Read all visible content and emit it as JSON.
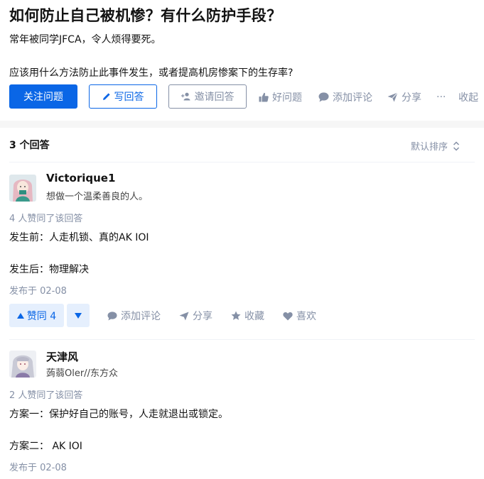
{
  "question": {
    "title": "如何防止自己被机惨？有什么防护手段？",
    "desc_line1": "常年被同学JFCA，令人烦得要死。",
    "desc_line2": "应该用什么方法防止此事件发生，或者提高机房惨案下的生存率?",
    "buttons": {
      "follow": "关注问题",
      "write": "写回答",
      "invite": "邀请回答"
    },
    "actions": {
      "good": "好问题",
      "comment": "添加评论",
      "share": "分享",
      "more": "···",
      "collect": "收起"
    }
  },
  "answers_header": {
    "count_label": "3 个回答",
    "sort_label": "默认排序"
  },
  "answers": [
    {
      "author": "Victorique1",
      "bio": "想做一个温柔善良的人。",
      "votes_text": "4 人赞同了该回答",
      "content": [
        "发生前：人走机锁、真的AK IOI",
        "发生后：物理解决"
      ],
      "date": "发布于 02-08",
      "vote_label": "赞同 4",
      "actions": {
        "comment": "添加评论",
        "share": "分享",
        "collect": "收藏",
        "like": "喜欢"
      }
    },
    {
      "author": "天津风",
      "bio": "蒟蒻Oler//东方众",
      "votes_text": "2 人赞同了该回答",
      "content": [
        "方案一：保护好自己的账号，人走就退出或锁定。",
        "方案二： AK IOI"
      ],
      "date": "发布于 02-08"
    }
  ],
  "colors": {
    "primary": "#0a66e6",
    "muted": "#8590a6",
    "vote_bg": "#e5effd",
    "divider": "#f6f6f6"
  }
}
